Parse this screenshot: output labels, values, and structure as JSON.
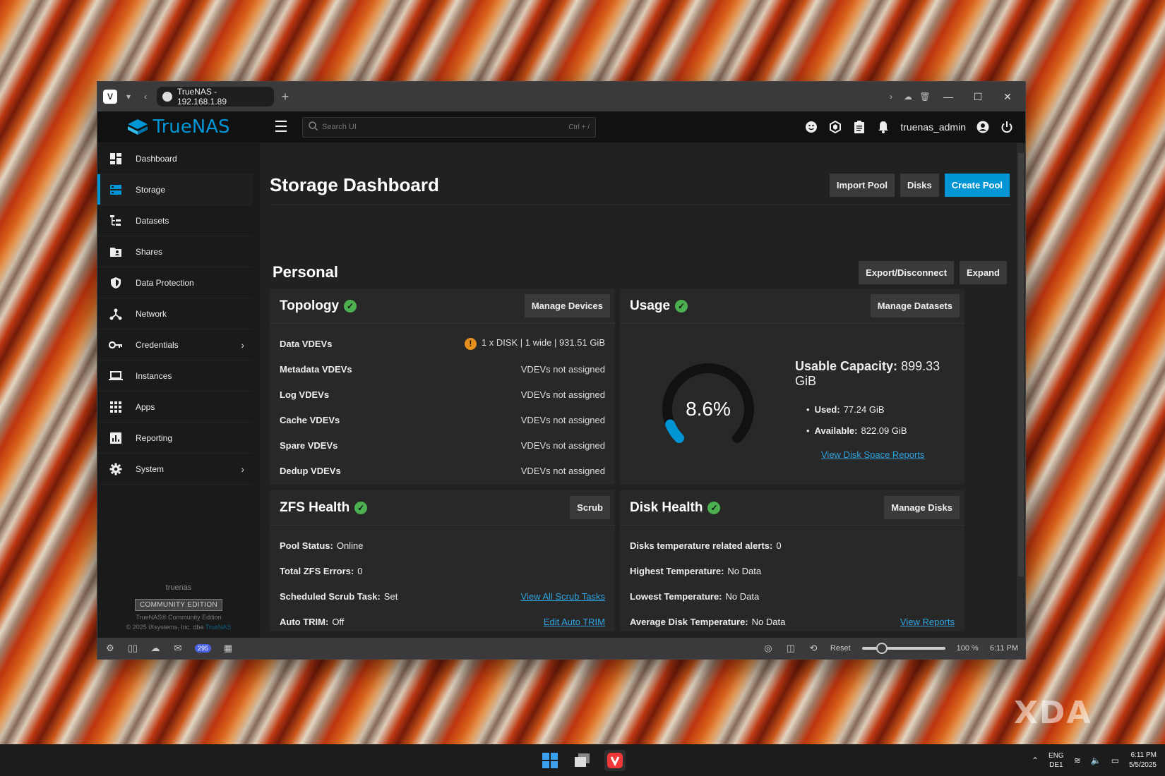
{
  "browser": {
    "tab_title": "TrueNAS - 192.168.1.89",
    "new_tab": "+",
    "zoom_reset": "Reset",
    "zoom_level": "100 %",
    "clock": "6:11 PM",
    "mail_badge": "295"
  },
  "app": {
    "logo_text": "TrueNAS",
    "search_placeholder": "Search UI",
    "search_shortcut": "Ctrl + /",
    "username": "truenas_admin"
  },
  "sidebar": {
    "items": [
      {
        "label": "Dashboard"
      },
      {
        "label": "Storage"
      },
      {
        "label": "Datasets"
      },
      {
        "label": "Shares"
      },
      {
        "label": "Data Protection"
      },
      {
        "label": "Network"
      },
      {
        "label": "Credentials"
      },
      {
        "label": "Instances"
      },
      {
        "label": "Apps"
      },
      {
        "label": "Reporting"
      },
      {
        "label": "System"
      }
    ],
    "active_index": 1,
    "hostname": "truenas",
    "edition": "COMMUNITY EDITION",
    "copyright_line1": "TrueNAS® Community Edition",
    "copyright_line2": "© 2025 iXsystems, Inc. dba",
    "copyright_brand": "TrueNAS"
  },
  "page": {
    "title": "Storage Dashboard",
    "import_pool": "Import Pool",
    "disks": "Disks",
    "create_pool": "Create Pool"
  },
  "pool": {
    "name": "Personal",
    "export_disconnect": "Export/Disconnect",
    "expand": "Expand"
  },
  "topology": {
    "title": "Topology",
    "manage_button": "Manage Devices",
    "rows": [
      {
        "label": "Data VDEVs",
        "value": "1 x DISK | 1 wide | 931.51 GiB",
        "warning": "!"
      },
      {
        "label": "Metadata VDEVs",
        "value": "VDEVs not assigned"
      },
      {
        "label": "Log VDEVs",
        "value": "VDEVs not assigned"
      },
      {
        "label": "Cache VDEVs",
        "value": "VDEVs not assigned"
      },
      {
        "label": "Spare VDEVs",
        "value": "VDEVs not assigned"
      },
      {
        "label": "Dedup VDEVs",
        "value": "VDEVs not assigned"
      }
    ]
  },
  "usage": {
    "title": "Usage",
    "manage_button": "Manage Datasets",
    "percent_label": "8.6%",
    "percent": 8.6,
    "capacity_label": "Usable Capacity:",
    "capacity_value": "899.33 GiB",
    "used_label": "Used:",
    "used_value": "77.24 GiB",
    "available_label": "Available:",
    "available_value": "822.09 GiB",
    "reports_link": "View Disk Space Reports"
  },
  "zfs_health": {
    "title": "ZFS Health",
    "scrub_button": "Scrub",
    "rows": [
      {
        "label": "Pool Status:",
        "value": "Online",
        "link": ""
      },
      {
        "label": "Total ZFS Errors:",
        "value": "0",
        "link": ""
      },
      {
        "label": "Scheduled Scrub Task:",
        "value": "Set",
        "link": "View All Scrub Tasks"
      },
      {
        "label": "Auto TRIM:",
        "value": "Off",
        "link": "Edit Auto TRIM"
      }
    ]
  },
  "disk_health": {
    "title": "Disk Health",
    "manage_button": "Manage Disks",
    "rows": [
      {
        "label": "Disks temperature related alerts:",
        "value": "0",
        "link": ""
      },
      {
        "label": "Highest Temperature:",
        "value": "No Data",
        "link": ""
      },
      {
        "label": "Lowest Temperature:",
        "value": "No Data",
        "link": ""
      },
      {
        "label": "Average Disk Temperature:",
        "value": "No Data",
        "link": "View Reports"
      }
    ]
  },
  "taskbar": {
    "lang_line1": "ENG",
    "lang_line2": "DE1",
    "time": "6:11 PM",
    "date": "5/5/2025"
  },
  "watermark": "XDA",
  "colors": {
    "accent": "#0095d5",
    "success": "#4caf50",
    "warning": "#e8901d",
    "link": "#2fa3e0"
  }
}
